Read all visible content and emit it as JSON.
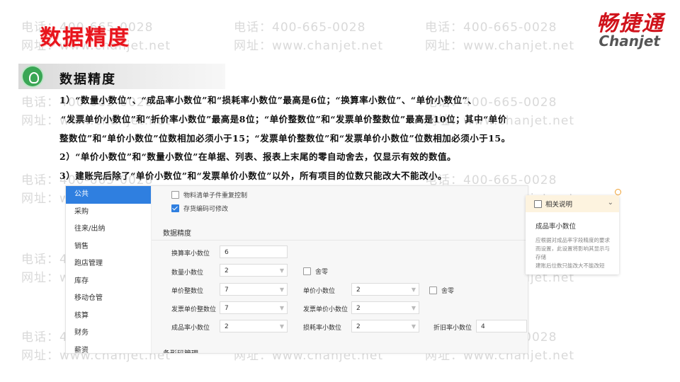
{
  "header": {
    "title": "数据精度",
    "logo_cn": "畅捷通",
    "logo_en": "Chanjet"
  },
  "watermark": {
    "phone": "电话：400-665-0028",
    "site": "网址：www.chanjet.net"
  },
  "section": {
    "title": "数据精度",
    "lines": [
      "1）“数量小数位”、“成品率小数位”和“损耗率小数位”最高是6位；“换算率小数位”、“单价小数位”、",
      "“发票单价小数位”和“折价率小数位”最高是8位；“单价整数位”和“发票单价整数位”最高是10位；其中“单价",
      "整数位”和“单价小数位”位数相加必须小于15；“发票单价整数位”和“发票单价小数位”位数相加必须小于15。",
      "2）“单价小数位”和“数量小数位”在单据、列表、报表上末尾的零自动舍去，仅显示有效的数值。",
      "3）建账完后除了“单价小数位”和“发票单价小数位”以外，所有项目的位数只能改大不能改小。"
    ]
  },
  "screenshot": {
    "menu": [
      "公共",
      "采购",
      "往来/出纳",
      "销售",
      "跑店管理",
      "库存",
      "移动仓管",
      "核算",
      "财务",
      "薪资"
    ],
    "active_menu": "公共",
    "checkboxes": [
      {
        "label": "物料清单子件重复控制",
        "checked": false
      },
      {
        "label": "存货编码可修改",
        "checked": true
      }
    ],
    "group_title": "数据精度",
    "fields": {
      "conv_rate_label": "换算率小数位",
      "conv_rate_value": "6",
      "qty_label": "数量小数位",
      "qty_value": "2",
      "qty_round_label": "舍零",
      "price_int_label": "单价整数位",
      "price_int_value": "7",
      "price_dec_label": "单价小数位",
      "price_dec_value": "2",
      "price_round_label": "舍零",
      "inv_int_label": "发票单价整数位",
      "inv_int_value": "7",
      "inv_dec_label": "发票单价小数位",
      "inv_dec_value": "2",
      "yield_label": "成品率小数位",
      "yield_value": "2",
      "loss_label": "损耗率小数位",
      "loss_value": "2",
      "dep_label": "折旧率小数位",
      "dep_value": "4"
    },
    "next_group": "条形码管理"
  },
  "help": {
    "header": "相关说明",
    "title": "成品率小数位",
    "body": "应根据对成品率字段精度的要求而设置，此设置将影响其显示与存储\n建账后位数只能改大不能改短"
  },
  "colors": {
    "accent": "#2f7fe0",
    "title_red": "#e8141c"
  }
}
